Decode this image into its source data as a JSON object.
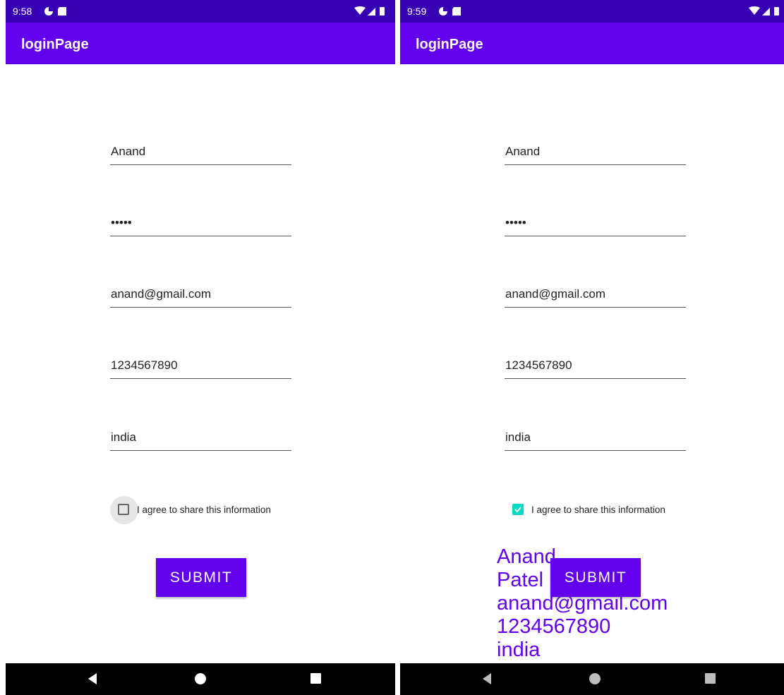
{
  "left": {
    "status": {
      "time": "9:58"
    },
    "app_title": "loginPage",
    "fields": {
      "name": "Anand",
      "password": "•••••",
      "email": "anand@gmail.com",
      "phone": "1234567890",
      "country": "india"
    },
    "checkbox": {
      "label": "I agree to share this information",
      "checked": false
    },
    "submit_label": "SUBMIT"
  },
  "right": {
    "status": {
      "time": "9:59"
    },
    "app_title": "loginPage",
    "fields": {
      "name": "Anand",
      "password": "•••••",
      "email": "anand@gmail.com",
      "phone": "1234567890",
      "country": "india"
    },
    "checkbox": {
      "label": "I agree to share this information",
      "checked": true
    },
    "submit_label": "SUBMIT",
    "result_lines": [
      "Anand",
      "Patel",
      "anand@gmail.com",
      "1234567890",
      "india"
    ]
  },
  "icons": {
    "status_left": [
      "data-saver-icon",
      "sd-card-icon"
    ],
    "status_right": [
      "wifi-icon",
      "cell-signal-icon",
      "battery-icon"
    ],
    "nav": [
      "back-icon",
      "home-icon",
      "recents-icon"
    ]
  },
  "colors": {
    "status_bar": "#3700b3",
    "app_bar": "#6200ee",
    "checkbox_checked": "#03dac5",
    "accent_text": "#6200ee"
  }
}
